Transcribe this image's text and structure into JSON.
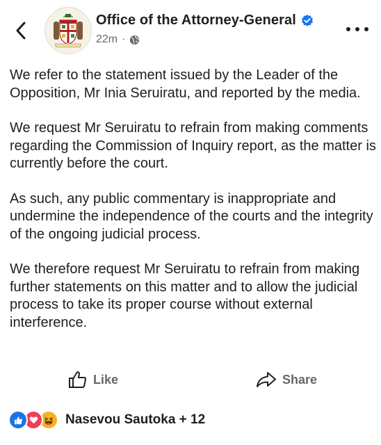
{
  "header": {
    "page_name": "Office of the Attorney-General",
    "time_ago": "22m",
    "separator": "·"
  },
  "post": {
    "paragraphs": [
      "We refer to the statement issued by the Leader of the Opposition, Mr Inia Seruiratu, and reported by the media.",
      "We request Mr Seruiratu to refrain from making comments regarding the Commission of Inquiry report, as the matter is currently before the court.",
      "As such, any public commentary is inappropriate and undermine the independence of the courts and the integrity of the ongoing judicial process.",
      "We therefore request Mr Seruiratu to refrain from making further statements on this matter and to allow the judicial process to take its proper course without external interference."
    ]
  },
  "actions": {
    "like_label": "Like",
    "share_label": "Share"
  },
  "reactions": {
    "summary": "Nasevou Sautoka + 12",
    "types": [
      "like-icon",
      "love-icon",
      "haha-icon"
    ]
  },
  "colors": {
    "verified": "#1877f2",
    "secondary_text": "#65676b",
    "like": "#1b74e4",
    "love": "#f33e58",
    "haha": "#f7b125"
  }
}
